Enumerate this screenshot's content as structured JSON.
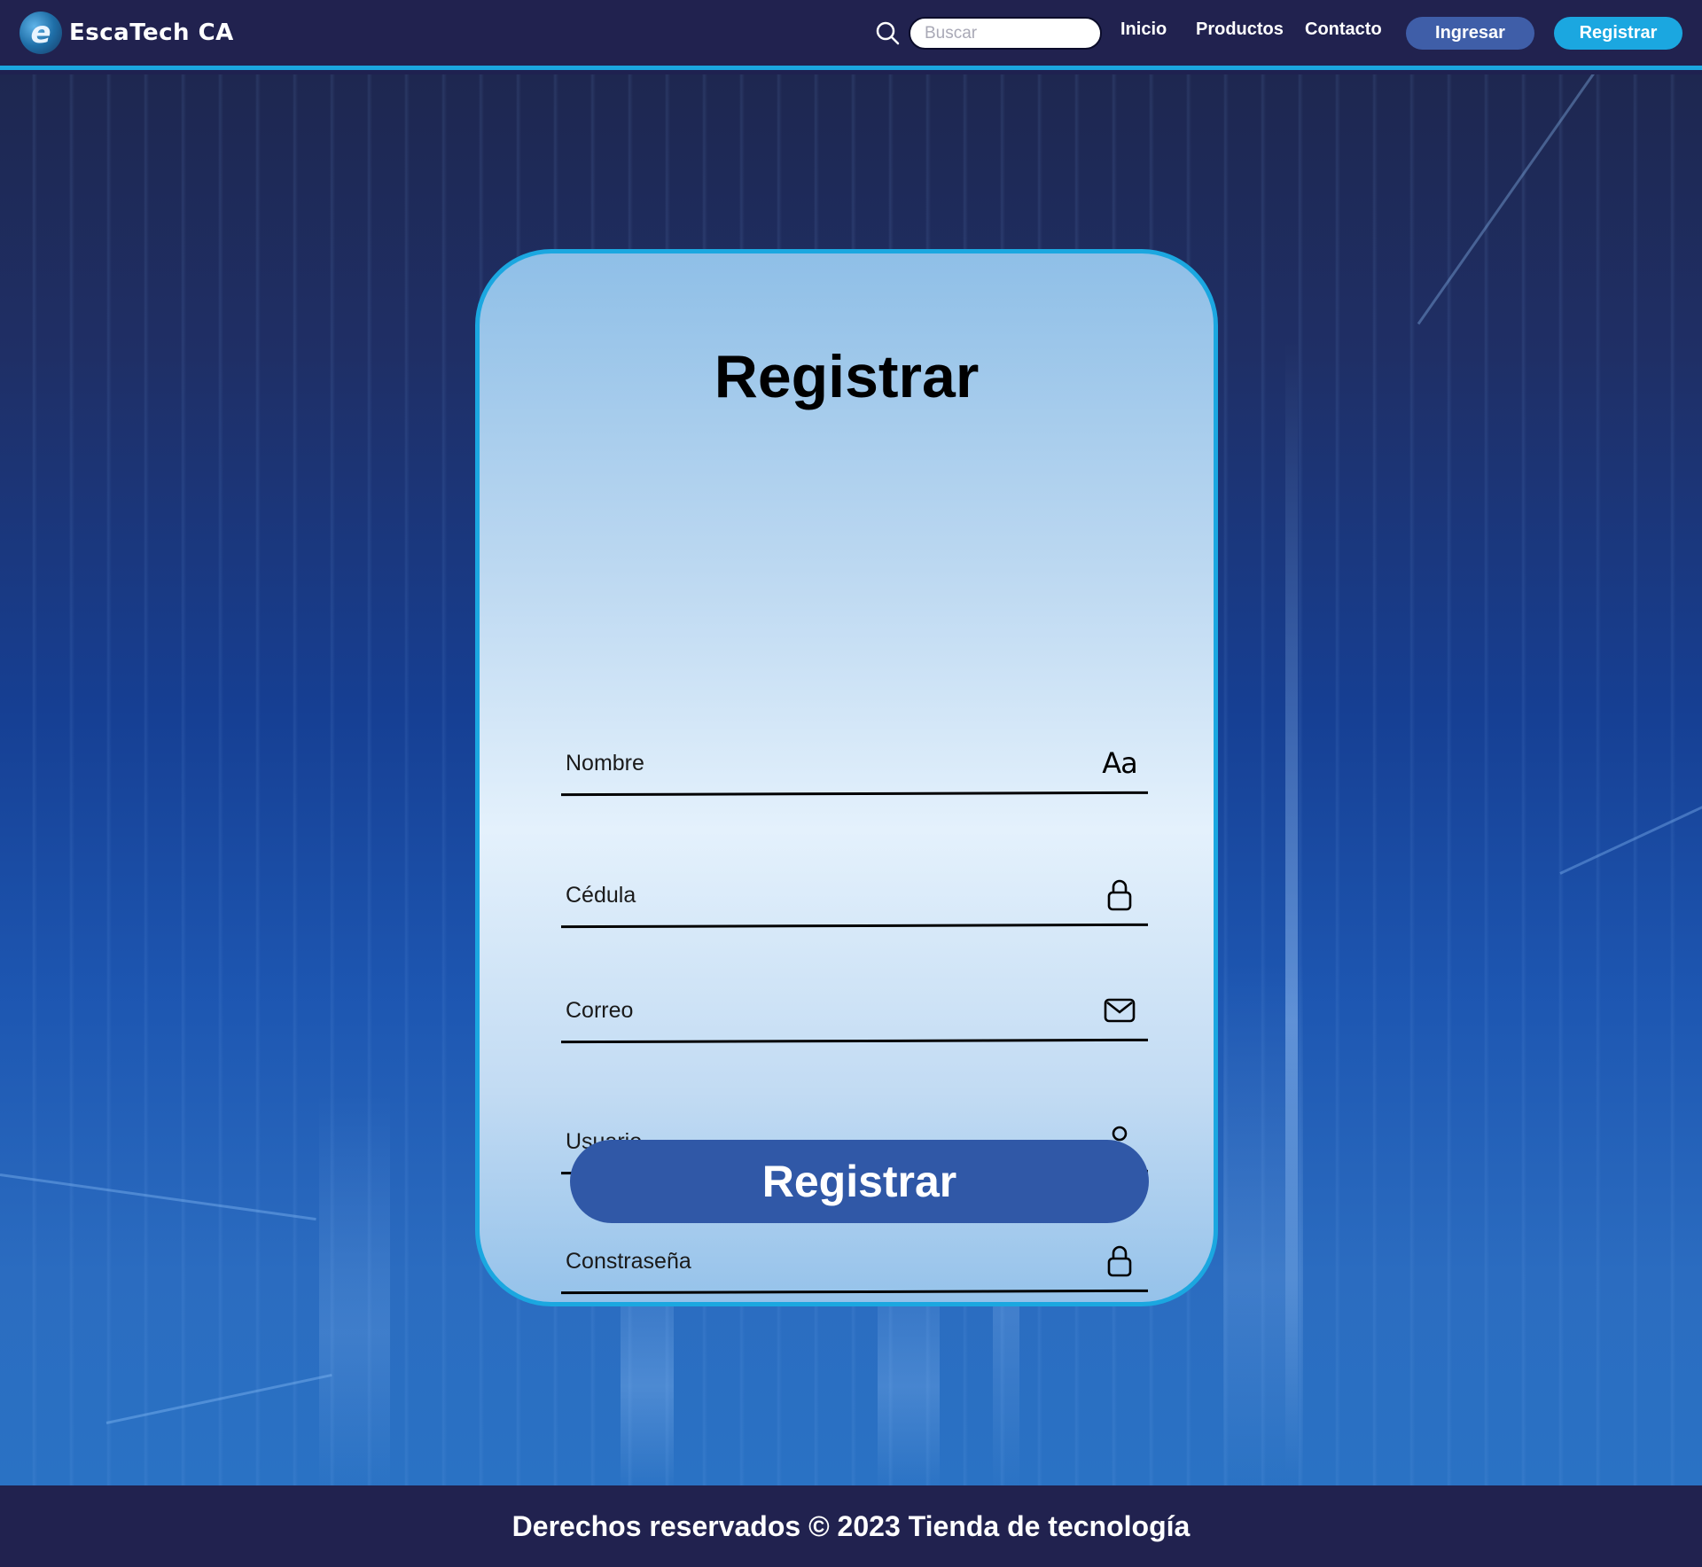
{
  "header": {
    "brand_logo_letter": "e",
    "brand_name": "EscaTech CA",
    "search": {
      "placeholder": "Buscar",
      "value": ""
    },
    "nav": {
      "inicio": "Inicio",
      "productos": "Productos",
      "contacto": "Contacto"
    },
    "buttons": {
      "ingresar": "Ingresar",
      "registrar": "Registrar"
    }
  },
  "form": {
    "title": "Registrar",
    "fields": [
      {
        "label": "Nombre",
        "icon": "text-aa-icon"
      },
      {
        "label": "Cédula",
        "icon": "lock-icon"
      },
      {
        "label": "Correo",
        "icon": "mail-icon"
      },
      {
        "label": "Usuario",
        "icon": "user-icon"
      },
      {
        "label": "Constraseña",
        "icon": "lock-icon"
      }
    ],
    "submit_label": "Registrar"
  },
  "footer": {
    "text": "Derechos reservados © 2023 Tienda de tecnología"
  },
  "colors": {
    "header_bg": "#21224f",
    "accent": "#1ba7e0",
    "ingresar_btn": "#3f5ea8",
    "submit_btn": "#3058a7"
  }
}
